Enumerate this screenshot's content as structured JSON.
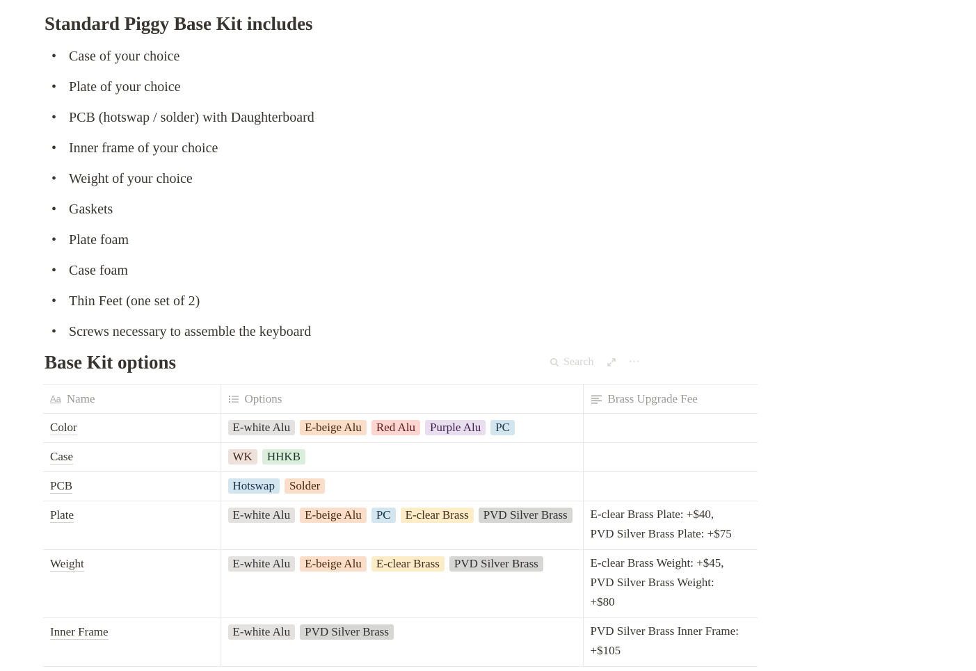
{
  "heading_kit": "Standard Piggy Base Kit includes",
  "kit_items": [
    "Case of your choice",
    "Plate of your choice",
    "PCB (hotswap / solder) with Daughterboard",
    "Inner frame of your choice",
    "Weight of your choice",
    "Gaskets",
    "Plate foam",
    "Case foam",
    "Thin Feet (one set of 2)",
    "Screws necessary to assemble the keyboard"
  ],
  "bullet": "•",
  "heading_options": "Base Kit options",
  "toolbar": {
    "search_label": "Search",
    "search_icon": "search-icon",
    "expand_icon": "expand-icon",
    "more_label": "···"
  },
  "table": {
    "columns": {
      "name": "Name",
      "options": "Options",
      "fee": "Brass Upgrade Fee"
    },
    "column_icons": {
      "name": "Aa",
      "options": "list-icon",
      "fee": "text-icon"
    },
    "tag_colors": {
      "gray": {
        "bg": "#e3e2e0",
        "fg": "#32302c"
      },
      "orange": {
        "bg": "#fadec9",
        "fg": "#49290e"
      },
      "red": {
        "bg": "#ffd5d2",
        "fg": "#5d1715"
      },
      "purple": {
        "bg": "#e8deee",
        "fg": "#412454"
      },
      "blue": {
        "bg": "#d3e5ef",
        "fg": "#183347"
      },
      "brown": {
        "bg": "#eee0da",
        "fg": "#442a1e"
      },
      "green": {
        "bg": "#dbeddb",
        "fg": "#1c3829"
      },
      "yellow": {
        "bg": "#fdecc8",
        "fg": "#402c1b"
      },
      "darkgray": {
        "bg": "#d6d6d4",
        "fg": "#32302c"
      }
    },
    "rows": [
      {
        "name": "Color",
        "options": [
          {
            "label": "E-white Alu",
            "color": "gray"
          },
          {
            "label": "E-beige Alu",
            "color": "orange"
          },
          {
            "label": "Red Alu",
            "color": "red"
          },
          {
            "label": "Purple Alu",
            "color": "purple"
          },
          {
            "label": "PC",
            "color": "blue"
          }
        ],
        "fee": []
      },
      {
        "name": "Case",
        "options": [
          {
            "label": "WK",
            "color": "brown"
          },
          {
            "label": "HHKB",
            "color": "green"
          }
        ],
        "fee": []
      },
      {
        "name": "PCB",
        "options": [
          {
            "label": "Hotswap",
            "color": "blue"
          },
          {
            "label": "Solder",
            "color": "orange"
          }
        ],
        "fee": []
      },
      {
        "name": "Plate",
        "options": [
          {
            "label": "E-white Alu",
            "color": "gray"
          },
          {
            "label": "E-beige Alu",
            "color": "orange"
          },
          {
            "label": "PC",
            "color": "blue"
          },
          {
            "label": "E-clear Brass",
            "color": "yellow"
          },
          {
            "label": "PVD Silver Brass",
            "color": "darkgray"
          }
        ],
        "fee": [
          "E-clear Brass Plate: +$40,",
          "PVD Silver Brass Plate: +$75"
        ]
      },
      {
        "name": "Weight",
        "options": [
          {
            "label": "E-white Alu",
            "color": "gray"
          },
          {
            "label": "E-beige Alu",
            "color": "orange"
          },
          {
            "label": "E-clear Brass",
            "color": "yellow"
          },
          {
            "label": "PVD Silver Brass",
            "color": "darkgray"
          }
        ],
        "fee": [
          "E-clear Brass Weight: +$45,",
          "PVD Silver Brass Weight:",
          "+$80"
        ]
      },
      {
        "name": "Inner Frame",
        "options": [
          {
            "label": "E-white Alu",
            "color": "gray"
          },
          {
            "label": "PVD Silver Brass",
            "color": "darkgray"
          }
        ],
        "fee": [
          "PVD Silver Brass Inner Frame:",
          "+$105"
        ]
      }
    ]
  }
}
